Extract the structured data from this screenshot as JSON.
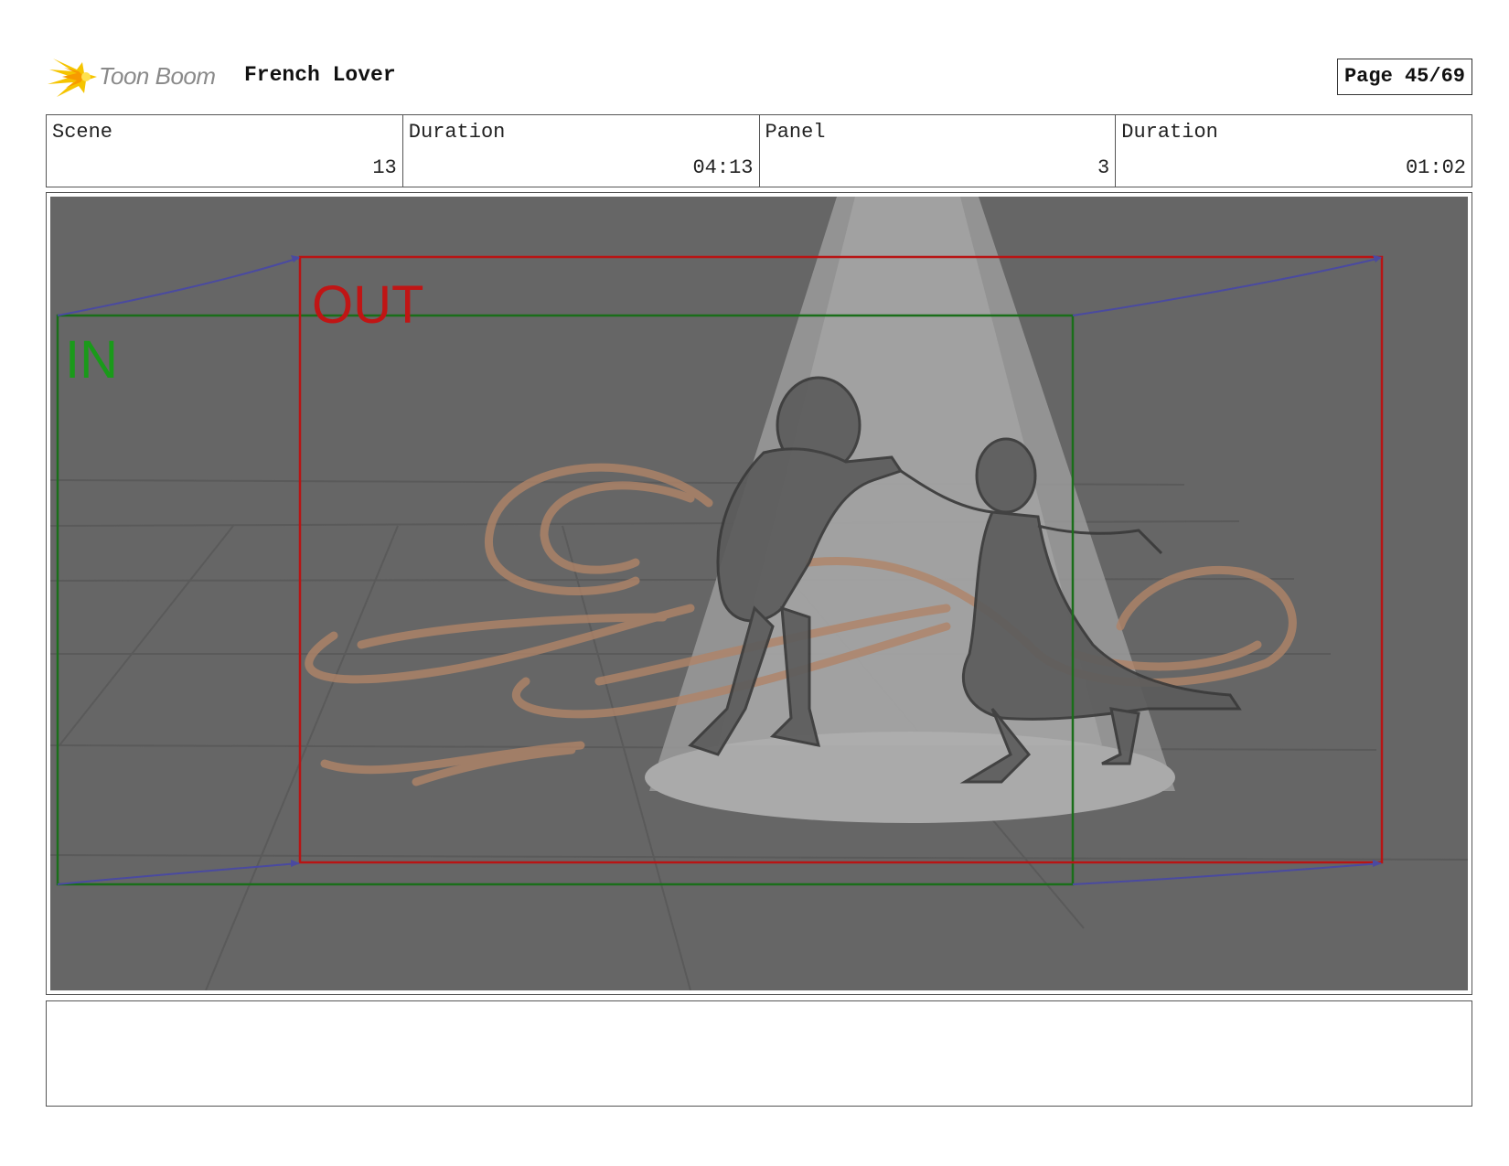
{
  "header": {
    "logo_text": "Toon Boom",
    "project_title": "French Lover",
    "page_label": "Page 45/69"
  },
  "info": {
    "scene_label": "Scene",
    "scene_value": "13",
    "scene_duration_label": "Duration",
    "scene_duration_value": "04:13",
    "panel_label": "Panel",
    "panel_value": "3",
    "panel_duration_label": "Duration",
    "panel_duration_value": "01:02"
  },
  "panel": {
    "in_label": "IN",
    "out_label": "OUT",
    "in_color": "#1a7a1a",
    "out_color": "#c01515",
    "background_color": "#666666"
  },
  "notes": {
    "text": ""
  }
}
